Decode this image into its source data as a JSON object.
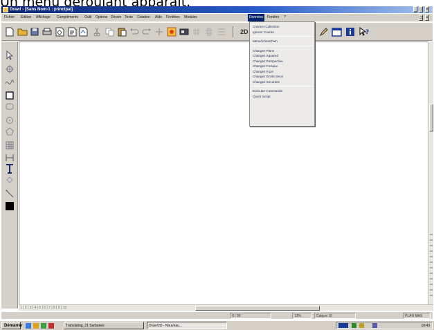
{
  "caption": "Un menu déroulant apparaît.",
  "window": {
    "title": "Draw! - [Sans Nom-1 : principal]",
    "controls": {
      "minimize": "_",
      "maximize": "□",
      "close": "×"
    }
  },
  "menubar": {
    "items": [
      "Fichier",
      "Edition",
      "Affichage",
      "Compléments",
      "Outil",
      "Options",
      "Dessin",
      "Texte",
      "Cotation",
      "Aide",
      "Fenêtres",
      "Modules",
      "Données",
      "Fenêtre",
      "?"
    ],
    "active_index": 12
  },
  "toolbar": {
    "zoom_label": "2D"
  },
  "dropdown": {
    "items": [
      {
        "label": "Connect Collection"
      },
      {
        "label": "Ignorer Courbe"
      },
      {
        "separator": true
      },
      {
        "label": "Menu/IcônesTwin"
      },
      {
        "separator": true
      },
      {
        "label": "Changez Plans"
      },
      {
        "label": "Changez Squared"
      },
      {
        "label": "Changez Perspective"
      },
      {
        "label": "Changez Fresque"
      },
      {
        "label": "Changez Fuze"
      },
      {
        "label": "Changez Droite Deux"
      },
      {
        "label": "Changez Secantes"
      },
      {
        "separator": true
      },
      {
        "label": "Exécuter Commande"
      },
      {
        "label": "Ouvrir Script"
      }
    ]
  },
  "pages": {
    "tabs": "1 | 2 | 3 | 4 | 5 | 6 | 7 | 8 | 9 | 10"
  },
  "statusbar": {
    "cells": [
      "0 / 99",
      "13%",
      "Calque 10",
      "PLAN MAS"
    ]
  },
  "taskbar": {
    "start_label": "Démarrer",
    "tasks": [
      "Translating_21 Sarbanes",
      "Draw!2D - Nouveau..."
    ],
    "clock": "10:43"
  },
  "colors": {
    "title_start": "#0a2470",
    "title_end": "#a6c3ee",
    "chrome": "#d4d0c8",
    "menu_highlight": "#0a246a"
  }
}
